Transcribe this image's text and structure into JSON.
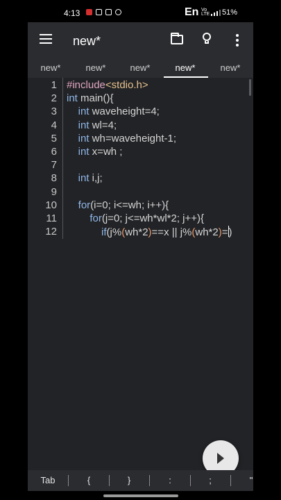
{
  "status": {
    "time": "4:13",
    "lang": "En",
    "net": "Vo LTE",
    "battery": "51%"
  },
  "toolbar": {
    "title": "new*"
  },
  "tabs": [
    "new*",
    "new*",
    "new*",
    "new*",
    "new*"
  ],
  "active_tab_index": 3,
  "editor": {
    "lines": [
      {
        "n": "1",
        "tokens": [
          {
            "t": "#include",
            "c": "pp"
          },
          {
            "t": "<stdio.h>",
            "c": "inc"
          }
        ]
      },
      {
        "n": "2",
        "tokens": [
          {
            "t": "int",
            "c": "kw"
          },
          {
            "t": " main(){",
            "c": ""
          }
        ]
      },
      {
        "n": "3",
        "tokens": [
          {
            "t": "    ",
            "c": ""
          },
          {
            "t": "int",
            "c": "kw"
          },
          {
            "t": " waveheight=4;",
            "c": ""
          }
        ]
      },
      {
        "n": "4",
        "tokens": [
          {
            "t": "    ",
            "c": ""
          },
          {
            "t": "int",
            "c": "kw"
          },
          {
            "t": " wl=4;",
            "c": ""
          }
        ]
      },
      {
        "n": "5",
        "tokens": [
          {
            "t": "    ",
            "c": ""
          },
          {
            "t": "int",
            "c": "kw"
          },
          {
            "t": " wh=waveheight-1;",
            "c": ""
          }
        ]
      },
      {
        "n": "6",
        "tokens": [
          {
            "t": "    ",
            "c": ""
          },
          {
            "t": "int",
            "c": "kw"
          },
          {
            "t": " x=wh ;",
            "c": ""
          }
        ]
      },
      {
        "n": "7",
        "tokens": []
      },
      {
        "n": "8",
        "tokens": [
          {
            "t": "    ",
            "c": ""
          },
          {
            "t": "int",
            "c": "kw"
          },
          {
            "t": " i,j;",
            "c": ""
          }
        ]
      },
      {
        "n": "9",
        "tokens": []
      },
      {
        "n": "10",
        "tokens": [
          {
            "t": "    ",
            "c": ""
          },
          {
            "t": "for",
            "c": "kw"
          },
          {
            "t": "(i=0; i<=wh; i++){",
            "c": ""
          }
        ]
      },
      {
        "n": "11",
        "tokens": [
          {
            "t": "        ",
            "c": ""
          },
          {
            "t": "for",
            "c": "kw"
          },
          {
            "t": "(j=0; j<=wh*wl*2; j++){",
            "c": ""
          }
        ]
      },
      {
        "n": "12",
        "tokens": [
          {
            "t": "            ",
            "c": ""
          },
          {
            "t": "if",
            "c": "kw"
          },
          {
            "t": "(",
            "c": ""
          },
          {
            "t": "j%",
            "c": ""
          },
          {
            "t": "(",
            "c": "par"
          },
          {
            "t": "wh*2",
            "c": ""
          },
          {
            "t": ")",
            "c": "par"
          },
          {
            "t": "==x || j%",
            "c": ""
          },
          {
            "t": "(",
            "c": "par"
          },
          {
            "t": "wh*2",
            "c": ""
          },
          {
            "t": ")",
            "c": "par"
          },
          {
            "t": "=",
            "c": ""
          },
          {
            "t": "CURSOR",
            "c": "cursor"
          },
          {
            "t": ")",
            "c": ""
          }
        ]
      }
    ]
  },
  "keybar": {
    "keys": [
      "Tab",
      "{",
      "}",
      ":",
      ";",
      "\""
    ]
  }
}
